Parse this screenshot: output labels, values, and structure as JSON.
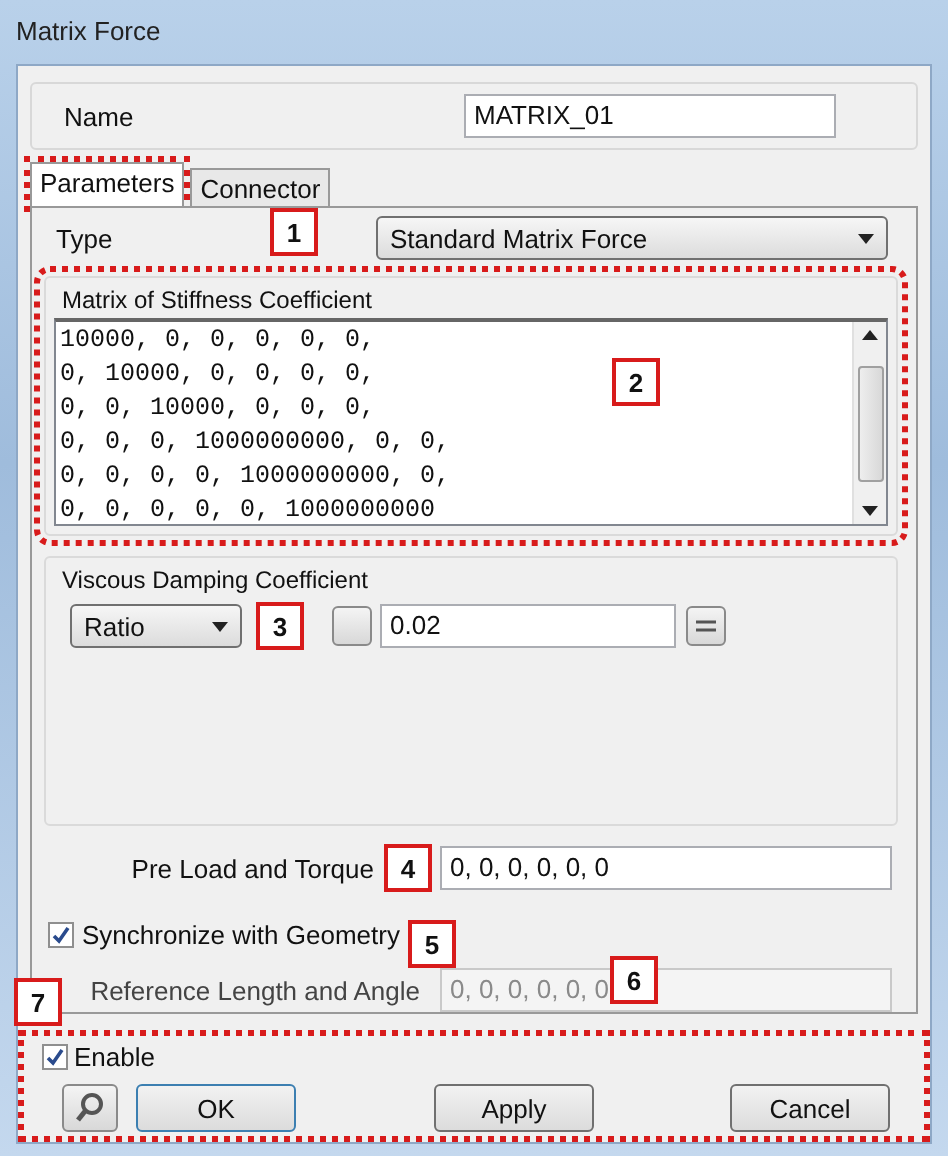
{
  "window": {
    "title": "Matrix Force"
  },
  "name": {
    "label": "Name",
    "value": "MATRIX_01"
  },
  "tabs": [
    {
      "label": "Parameters",
      "selected": true,
      "highlighted": true
    },
    {
      "label": "Connector",
      "selected": false,
      "highlighted": false
    }
  ],
  "type": {
    "label": "Type",
    "value": "Standard Matrix Force",
    "callout": "1"
  },
  "stiffness": {
    "title": "Matrix of Stiffness Coefficient",
    "highlighted": true,
    "callout": "2",
    "lines": [
      "10000, 0, 0, 0, 0, 0,",
      "0, 10000, 0, 0, 0, 0,",
      "0, 0, 10000, 0, 0, 0,",
      "0, 0, 0, 1000000000, 0, 0,",
      "0, 0, 0, 0, 1000000000, 0,",
      "0, 0, 0, 0, 0, 1000000000"
    ]
  },
  "damping": {
    "title": "Viscous Damping Coefficient",
    "mode": "Ratio",
    "callout": "3",
    "value": "0.02"
  },
  "preload": {
    "label": "Pre Load and Torque",
    "callout": "4",
    "value": "0, 0, 0, 0, 0, 0"
  },
  "synchronize": {
    "label": "Synchronize with Geometry",
    "checked": true,
    "callout": "5"
  },
  "reference": {
    "label": "Reference Length and Angle",
    "value": "0, 0, 0, 0, 0, 0",
    "disabled": true,
    "callout": "6"
  },
  "footer": {
    "callout": "7",
    "highlighted": true,
    "enable": {
      "label": "Enable",
      "checked": true
    },
    "buttons": [
      "OK",
      "Apply",
      "Cancel"
    ]
  }
}
